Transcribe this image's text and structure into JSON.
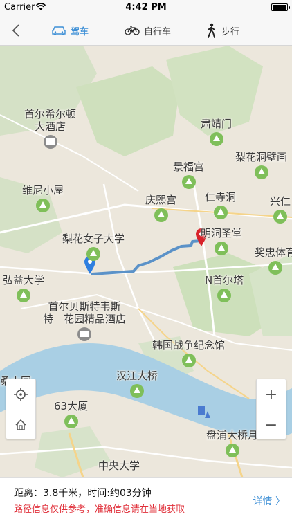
{
  "status_bar": {
    "carrier": "Carrier",
    "time": "4:42 PM"
  },
  "nav": {
    "tabs": [
      {
        "label": "驾车",
        "icon": "car-icon",
        "active": true
      },
      {
        "label": "自行车",
        "icon": "bicycle-icon",
        "active": false
      },
      {
        "label": "步行",
        "icon": "walking-icon",
        "active": false
      }
    ]
  },
  "map": {
    "pois": [
      {
        "name": "首尔希尔顿",
        "name2": "大酒店",
        "icon": "building"
      },
      {
        "name": "肃靖门",
        "icon": "park"
      },
      {
        "name": "梨花洞壁画",
        "icon": "park"
      },
      {
        "name": "景福宫",
        "icon": "park"
      },
      {
        "name": "维尼小屋",
        "icon": "park"
      },
      {
        "name": "庆熙宫",
        "icon": "park"
      },
      {
        "name": "仁寺洞",
        "icon": "park"
      },
      {
        "name": "兴仁",
        "icon": "park"
      },
      {
        "name": "梨花女子大学",
        "icon": "park"
      },
      {
        "name": "明洞圣堂",
        "icon": "park"
      },
      {
        "name": "奖忠体育",
        "icon": "park"
      },
      {
        "name": "弘益大学",
        "icon": "park"
      },
      {
        "name": "N首尔塔",
        "icon": "park"
      },
      {
        "name": "首尔贝斯特韦斯",
        "name2": "特　花园精品酒店",
        "icon": "building"
      },
      {
        "name": "韩国战争纪念馆",
        "icon": "park"
      },
      {
        "name": "汉江大桥",
        "icon": "park"
      },
      {
        "name": "63大厦",
        "icon": "park"
      },
      {
        "name": "盘浦大桥月",
        "icon": "park"
      },
      {
        "name": "中央大学",
        "icon": "park"
      },
      {
        "name": "桑水园",
        "icon": "none"
      }
    ],
    "route_color": "#5b92c8",
    "start_marker_color": "#2f7fe0",
    "end_marker_color": "#d8232a"
  },
  "controls": {
    "zoom_in": "+",
    "zoom_out": "−"
  },
  "info": {
    "distance": "距离：3.8千米，时间:约03分钟",
    "disclaimer": "路径信息仅供参考，准确信息请在当地获取",
    "details": "详情 〉"
  }
}
